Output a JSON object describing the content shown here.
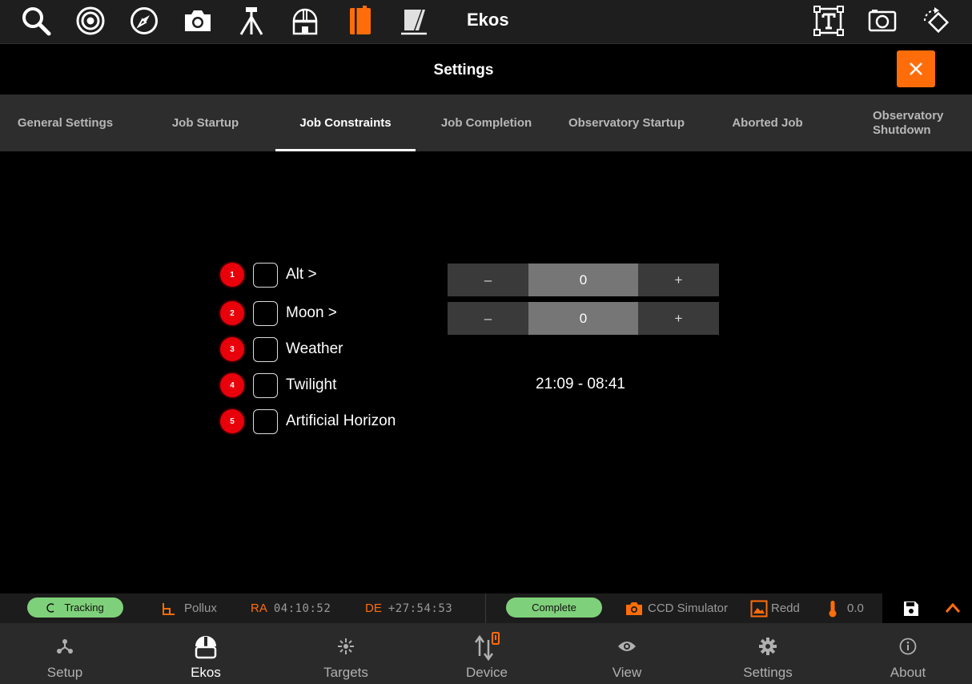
{
  "app": {
    "title": "Ekos"
  },
  "toolbar": {
    "icons": [
      "search-icon",
      "target-icon",
      "compass-icon",
      "camera-icon",
      "tripod-icon",
      "observatory-icon",
      "notebook-icon",
      "flat-panel-icon",
      "text-box-icon",
      "screenshot-icon",
      "rotate-icon"
    ]
  },
  "settings": {
    "title": "Settings",
    "close_label": "✕"
  },
  "tabs": [
    {
      "label": "General Settings"
    },
    {
      "label": "Job Startup"
    },
    {
      "label": "Job Constraints"
    },
    {
      "label": "Job Completion"
    },
    {
      "label": "Observatory Startup"
    },
    {
      "label": "Aborted Job"
    },
    {
      "label": "Observatory Shutdown"
    }
  ],
  "active_tab": "Job Constraints",
  "constraints": [
    {
      "number": "1",
      "label": "Alt >",
      "checked": false
    },
    {
      "number": "2",
      "label": "Moon >",
      "checked": false
    },
    {
      "number": "3",
      "label": "Weather",
      "checked": false
    },
    {
      "number": "4",
      "label": "Twilight",
      "checked": false
    },
    {
      "number": "5",
      "label": "Artificial Horizon",
      "checked": false
    }
  ],
  "steppers": {
    "alt": {
      "minus": "–",
      "value": "0",
      "plus": "+"
    },
    "moon": {
      "minus": "–",
      "value": "0",
      "plus": "+"
    }
  },
  "twilight_time": "21:09 - 08:41",
  "status": {
    "tracking": "Tracking",
    "target": "Pollux",
    "ra_label": "RA",
    "ra_value": "04:10:52",
    "de_label": "DE",
    "de_value": "+27:54:53",
    "complete": "Complete",
    "camera": "CCD Simulator",
    "filter": "Redd",
    "temperature": "0.0"
  },
  "nav": [
    {
      "label": "Setup",
      "icon": "setup-icon"
    },
    {
      "label": "Ekos",
      "icon": "dome-icon"
    },
    {
      "label": "Targets",
      "icon": "targets-icon"
    },
    {
      "label": "Device",
      "icon": "device-icon"
    },
    {
      "label": "View",
      "icon": "eye-icon"
    },
    {
      "label": "Settings",
      "icon": "gear-icon"
    },
    {
      "label": "About",
      "icon": "info-icon"
    }
  ],
  "colors": {
    "accent": "#ff6d0a",
    "badge": "#e8000b",
    "pill": "#7fd07a"
  }
}
